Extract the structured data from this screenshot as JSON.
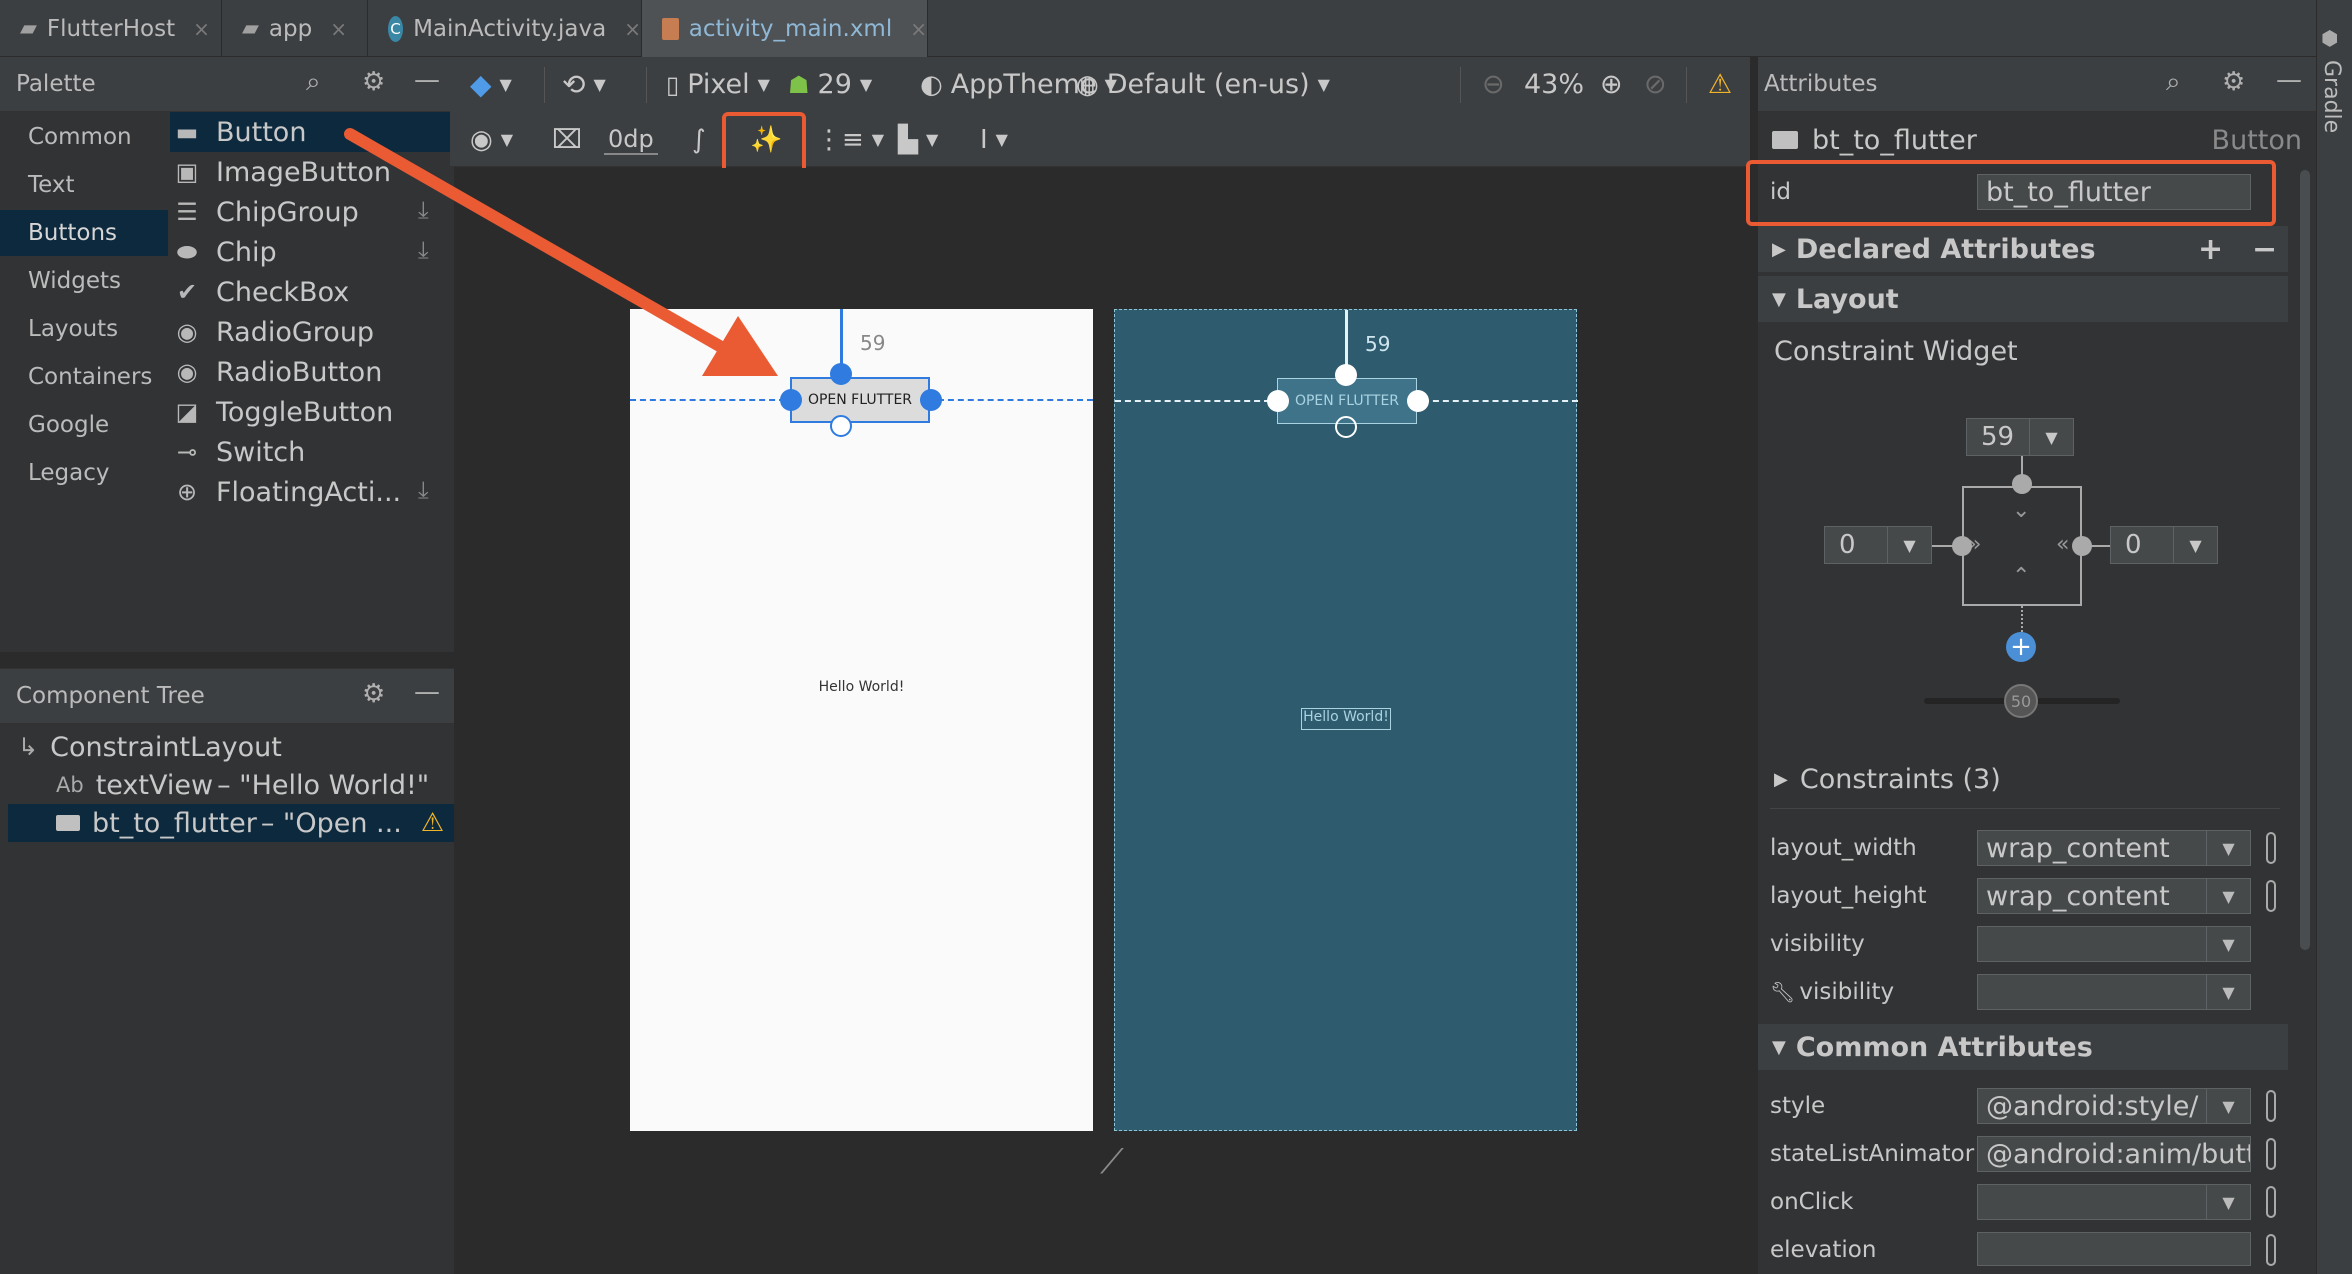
{
  "tabs": [
    {
      "label": "FlutterHost",
      "icon": "folder-icon"
    },
    {
      "label": "app",
      "icon": "folder-icon"
    },
    {
      "label": "MainActivity.java",
      "icon": "class-icon",
      "badge": "C"
    },
    {
      "label": "activity_main.xml",
      "icon": "layout-file-icon"
    }
  ],
  "close_glyph": "×",
  "palette": {
    "title": "Palette",
    "categories": [
      "Common",
      "Text",
      "Buttons",
      "Widgets",
      "Layouts",
      "Containers",
      "Google",
      "Legacy"
    ],
    "selected_category": "Buttons",
    "items": [
      {
        "label": "Button",
        "icon": "button-icon"
      },
      {
        "label": "ImageButton",
        "icon": "image-button-icon"
      },
      {
        "label": "ChipGroup",
        "icon": "chip-group-icon"
      },
      {
        "label": "Chip",
        "icon": "chip-icon"
      },
      {
        "label": "CheckBox",
        "icon": "checkbox-icon"
      },
      {
        "label": "RadioGroup",
        "icon": "radio-group-icon"
      },
      {
        "label": "RadioButton",
        "icon": "radio-button-icon"
      },
      {
        "label": "ToggleButton",
        "icon": "toggle-button-icon"
      },
      {
        "label": "Switch",
        "icon": "switch-icon"
      },
      {
        "label": "FloatingActi...",
        "icon": "fab-icon"
      }
    ]
  },
  "component_tree": {
    "title": "Component Tree",
    "items": [
      {
        "label": "ConstraintLayout",
        "icon": "constraint-layout-icon"
      },
      {
        "prefix": "Ab",
        "label": "textView",
        "suffix": "– \"Hello World!\""
      },
      {
        "label": "bt_to_flutter",
        "suffix": "– \"Open ...",
        "warning": true
      }
    ]
  },
  "toolbar": {
    "device": "Pixel",
    "api": "29",
    "theme": "AppTheme",
    "locale": "Default (en-us)",
    "zoom": "43%",
    "margin": "0dp"
  },
  "canvas": {
    "top_margin": "59",
    "button_text": "OPEN FLUTTER",
    "hello_text": "Hello World!"
  },
  "attributes": {
    "title": "Attributes",
    "widget_name": "bt_to_flutter",
    "widget_type": "Button",
    "id_label": "id",
    "id_value": "bt_to_flutter",
    "declared_attributes": "Declared Attributes",
    "layout_section": "Layout",
    "constraint_widget": "Constraint Widget",
    "constraint_top": "59",
    "constraint_left": "0",
    "constraint_right": "0",
    "bias": "50",
    "constraints": "Constraints (3)",
    "layout_rows": [
      {
        "label": "layout_width",
        "value": "wrap_content"
      },
      {
        "label": "layout_height",
        "value": "wrap_content"
      },
      {
        "label": "visibility",
        "value": ""
      },
      {
        "label": "visibility",
        "value": "",
        "tool": true
      }
    ],
    "common_section": "Common Attributes",
    "common_rows": [
      {
        "label": "style",
        "value": "@android:style/"
      },
      {
        "label": "stateListAnimator",
        "value": "@android:anim/butto"
      },
      {
        "label": "onClick",
        "value": ""
      },
      {
        "label": "elevation",
        "value": ""
      }
    ]
  },
  "side_tab": "Gradle",
  "colors": {
    "accent": "#ea5a33",
    "blueprint": "#2e5b6e",
    "selection": "#3d7fe0"
  }
}
